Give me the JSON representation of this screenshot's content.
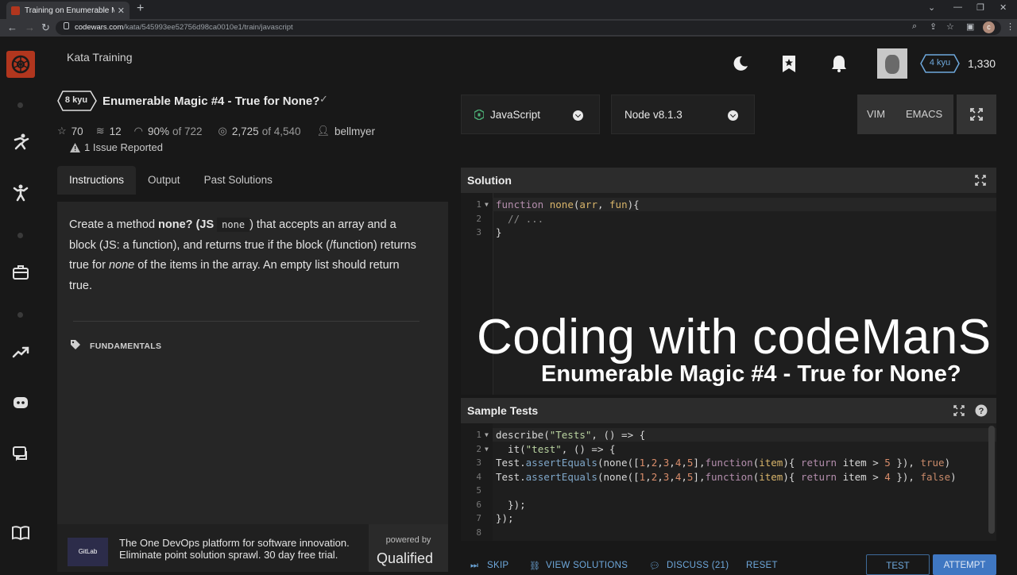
{
  "browser": {
    "tab_title": "Training on Enumerable Magic #",
    "url_host": "codewars.com",
    "url_path": "/kata/545993ee52756d98ca0010e1/train/javascript",
    "profile_initial": "c"
  },
  "header": {
    "section_title": "Kata Training",
    "rank": "4 kyu",
    "honor": "1,330"
  },
  "kata": {
    "kyu": "8 kyu",
    "title": "Enumerable Magic #4 - True for None?",
    "stars": "70",
    "collections": "12",
    "satisfaction": "90%",
    "satisfaction_of": "of 722",
    "completed": "2,725",
    "completed_of": "of 4,540",
    "author": "bellmyer",
    "issues": "1 Issue Reported"
  },
  "tabs": [
    "Instructions",
    "Output",
    "Past Solutions"
  ],
  "instructions": {
    "p1": "Create a method ",
    "p1_bold": "none?",
    "p2": " (JS ",
    "p2_code": "none",
    "p3": ") that accepts an array and a block (JS: a function), and returns true if the block (/function) returns true for ",
    "p3_italic": "none",
    "p4": " of the items in the array. An empty list should return true.",
    "tag": "FUNDAMENTALS"
  },
  "ad": {
    "logo": "GitLab",
    "text": "The One DevOps platform for software innovation. Eliminate point solution sprawl. 30 day free trial.",
    "powered_by": "powered by",
    "brand": "Qualified"
  },
  "editor": {
    "language": "JavaScript",
    "runtime": "Node v8.1.3",
    "mode_vim": "VIM",
    "mode_emacs": "EMACS",
    "solution_title": "Solution",
    "tests_title": "Sample Tests"
  },
  "overlay": {
    "big": "Coding with codeManS",
    "sub": "Enumerable Magic #4 - True for None?"
  },
  "actions": {
    "skip": "SKIP",
    "view_solutions": "VIEW SOLUTIONS",
    "discuss": "DISCUSS (21)",
    "reset": "RESET",
    "test": "TEST",
    "attempt": "ATTEMPT"
  },
  "icons": {
    "logo": "codewars-logo",
    "theme": "moon-icon",
    "bookmark": "bookmark-star-icon",
    "notifications": "bell-icon",
    "fullscreen": "expand-icon"
  },
  "colors": {
    "accent_red": "#b1361e",
    "link_blue": "#6ea8dc",
    "attempt_blue": "#3f77c2"
  }
}
